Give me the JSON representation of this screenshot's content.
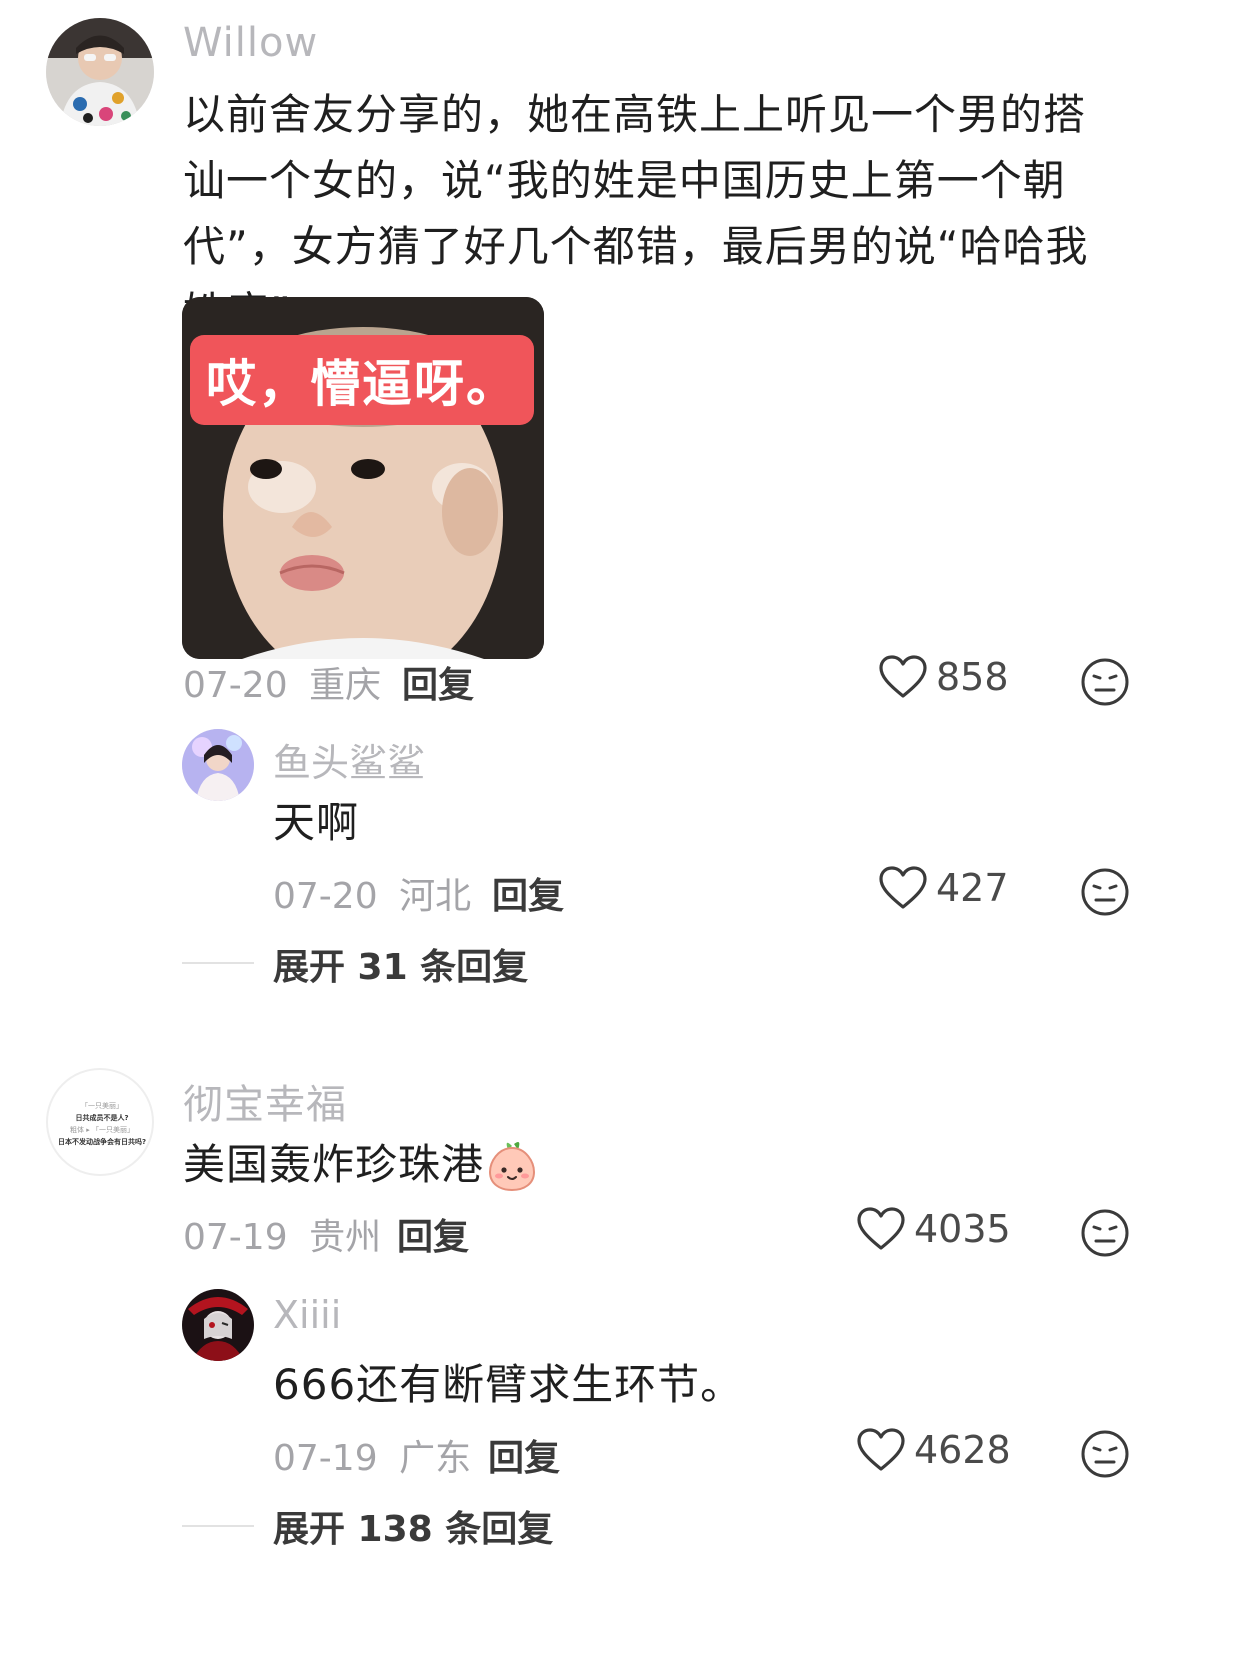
{
  "comments": [
    {
      "username": "Willow",
      "text": "以前舍友分享的，她在高铁上上听见一个男的搭讪一个女的，说“我的姓是中国历史上第一个朝代”，女方猜了好几个都错，最后男的说“哈哈我姓唐”",
      "image_caption": "哎，懵逼呀。",
      "date": "07-20",
      "location": "重庆",
      "reply_label": "回复",
      "likes": "858",
      "replies": [
        {
          "username": "鱼头鲨鲨",
          "text": "天啊",
          "date": "07-20",
          "location": "河北",
          "reply_label": "回复",
          "likes": "427"
        }
      ],
      "expand_label": "展开 31 条回复"
    },
    {
      "username": "彻宝幸福",
      "text": "美国轰炸珍珠港",
      "avatar_lines": [
        "「一只美丽」",
        "日共成员不是人?",
        "粗体 ▸ 「一只美丽」",
        "日本不发动战争会有日共吗?"
      ],
      "date": "07-19",
      "location": "贵州",
      "reply_label": "回复",
      "likes": "4035",
      "replies": [
        {
          "username": "Xiiii",
          "text": "666还有断臂求生环节。",
          "date": "07-19",
          "location": "广东",
          "reply_label": "回复",
          "likes": "4628"
        }
      ],
      "expand_label": "展开 138 条回复"
    }
  ],
  "icons": {
    "like": "heart-outline-icon",
    "dislike": "meh-face-icon",
    "emoji": "peach-face-emoji"
  }
}
